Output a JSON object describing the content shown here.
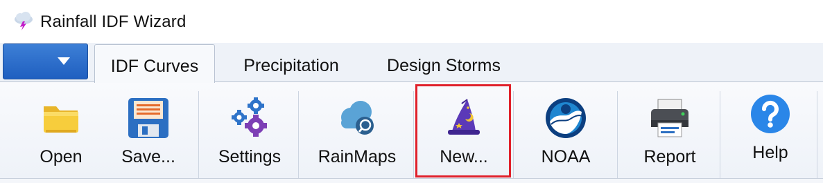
{
  "window": {
    "title": "Rainfall IDF Wizard",
    "app_icon": "storm-cloud-icon"
  },
  "tabs": [
    {
      "label": "IDF Curves",
      "active": true
    },
    {
      "label": "Precipitation",
      "active": false
    },
    {
      "label": "Design Storms",
      "active": false
    }
  ],
  "ribbon": {
    "buttons": [
      {
        "label": "Open",
        "icon": "folder-icon"
      },
      {
        "label": "Save...",
        "icon": "floppy-disk-icon"
      },
      {
        "label": "Settings",
        "icon": "gears-icon"
      },
      {
        "label": "RainMaps",
        "icon": "cloud-search-icon"
      },
      {
        "label": "New...",
        "icon": "wizard-hat-icon",
        "highlighted": true
      },
      {
        "label": "NOAA",
        "icon": "noaa-logo-icon"
      },
      {
        "label": "Report",
        "icon": "printer-icon"
      },
      {
        "label": "Help",
        "icon": "help-icon"
      }
    ]
  },
  "colors": {
    "highlight": "#e0202a",
    "app_menu": "#2a6ccc",
    "tab_strip": "#eef2f8"
  }
}
